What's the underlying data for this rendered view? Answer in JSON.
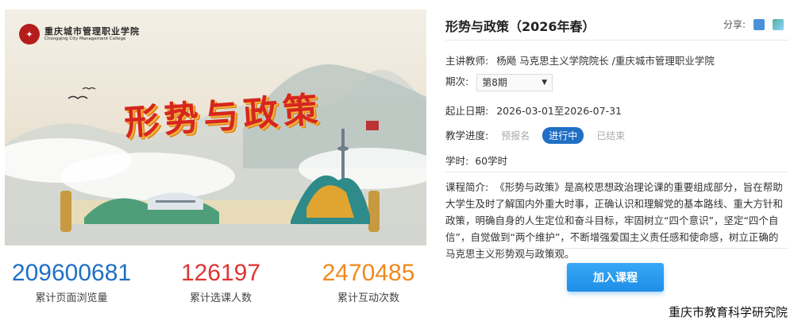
{
  "banner": {
    "school_name_cn": "重庆城市管理职业学院",
    "school_name_en": "Chongqing City Management College",
    "title_art": "形势与政策"
  },
  "stats": [
    {
      "value": "209600681",
      "label": "累计页面浏览量",
      "color": "#1f6fc5"
    },
    {
      "value": "126197",
      "label": "累计选课人数",
      "color": "#e03434"
    },
    {
      "value": "2470485",
      "label": "累计互动次数",
      "color": "#f0891e"
    }
  ],
  "course": {
    "title": "形势与政策（2026年春）",
    "share_label": "分享:",
    "teacher_label": "主讲教师:",
    "teacher_value": "杨飏 马克思主义学院院长 /重庆城市管理职业学院",
    "term_label": "期次:",
    "term_value": "第8期",
    "dates_label": "起止日期:",
    "dates_value": "2026-03-01至2026-07-31",
    "progress_label": "教学进度:",
    "progress_options": [
      "预报名",
      "进行中",
      "已结束"
    ],
    "progress_active": "进行中",
    "hours_label": "学时:",
    "hours_value": "60学时",
    "intro_label": "课程简介:",
    "intro_text": "《形势与政策》是高校思想政治理论课的重要组成部分，旨在帮助大学生及时了解国内外重大时事，正确认识和理解党的基本路线、重大方针和政策，明确自身的人生定位和奋斗目标，牢固树立“四个意识”，坚定“四个自信”，自觉做到“两个维护”，不断增强爱国主义责任感和使命感，树立正确的马克思主义形势观与政策观。",
    "join_button": "加入课程"
  },
  "watermark": "重庆市教育科学研究院",
  "colors": {
    "accent": "#1f6fc5",
    "button": "#2a9af0"
  }
}
